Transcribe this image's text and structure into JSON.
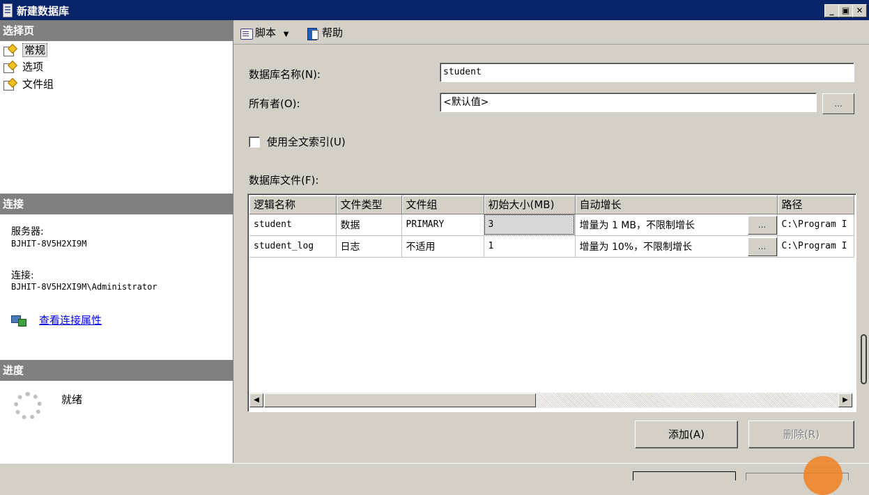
{
  "window": {
    "title": "新建数据库"
  },
  "left": {
    "select_page_header": "选择页",
    "pages": [
      {
        "label": "常规",
        "selected": true
      },
      {
        "label": "选项",
        "selected": false
      },
      {
        "label": "文件组",
        "selected": false
      }
    ],
    "connection_header": "连接",
    "server_label": "服务器:",
    "server_value": "BJHIT-8V5H2XI9M",
    "connection_label": "连接:",
    "connection_value": "BJHIT-8V5H2XI9M\\Administrator",
    "view_props_link": "查看连接属性",
    "progress_header": "进度",
    "progress_status": "就绪"
  },
  "toolbar": {
    "script_label": "脚本",
    "help_label": "帮助"
  },
  "form": {
    "db_name_label": "数据库名称(N):",
    "db_name_value": "student",
    "owner_label": "所有者(O):",
    "owner_value": "<默认值>",
    "ellipsis": "...",
    "fulltext_label": "使用全文索引(U)",
    "fulltext_checked": false,
    "files_label": "数据库文件(F):"
  },
  "grid": {
    "columns": [
      "逻辑名称",
      "文件类型",
      "文件组",
      "初始大小(MB)",
      "自动增长",
      "路径"
    ],
    "rows": [
      [
        "student",
        "数据",
        "PRIMARY",
        "3",
        "增量为 1 MB，不限制增长",
        "C:\\Program I"
      ],
      [
        "student_log",
        "日志",
        "不适用",
        "1",
        "增量为 10%，不限制增长",
        "C:\\Program I"
      ]
    ]
  },
  "buttons": {
    "add": "添加(A)",
    "remove": "删除(R)"
  }
}
